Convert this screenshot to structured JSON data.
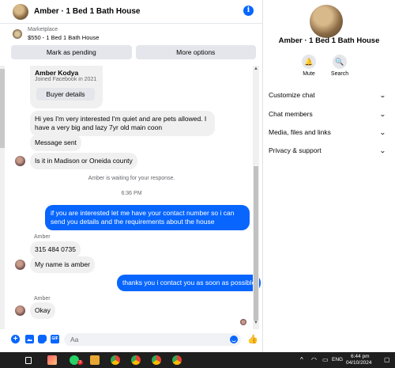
{
  "header": {
    "title": "Amber · 1 Bed 1 Bath House"
  },
  "listing": {
    "source": "Marketplace",
    "item": "$550 - 1 Bed 1 Bath House"
  },
  "actions": {
    "pending_label": "Mark as pending",
    "more_label": "More options"
  },
  "profile_card": {
    "name": "Amber Kodya",
    "joined": "Joined Facebook in 2021",
    "button": "Buyer details"
  },
  "messages": {
    "m1": "Hi yes I'm very interested I'm quiet and are pets allowed. I have a very big and lazy 7yr old main coon",
    "m2": "Message sent",
    "m3": "Is it in Madison or Oneida county",
    "waiting": "Amber is waiting for your response.",
    "time": "6:36 PM",
    "m4": "if you are interested let me have your contact number so i can send you details and the requirements about the house",
    "sender1": "Amber",
    "m5": "315 484 0735",
    "m6": "My name is amber",
    "m7": "thanks you i contact you as soon as possible",
    "sender2": "Amber",
    "m8": "Okay"
  },
  "composer": {
    "placeholder": "Aa"
  },
  "side": {
    "title": "Amber · 1 Bed 1 Bath House",
    "mute_label": "Mute",
    "search_label": "Search",
    "menu": [
      "Customize chat",
      "Chat members",
      "Media, files and links",
      "Privacy & support"
    ]
  },
  "taskbar": {
    "lang": "ENG",
    "time": "6:44 pm",
    "date": "04/10/2024",
    "badge": "3"
  },
  "colors": {
    "accent": "#0866ff",
    "bubble_in": "#f0f0f0",
    "taskbar": "#1f1f1f"
  }
}
